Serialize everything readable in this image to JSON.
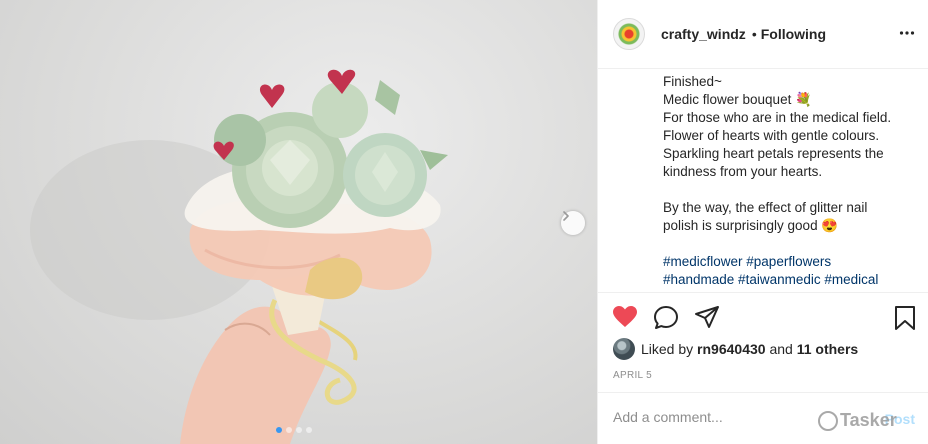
{
  "post": {
    "username": "crafty_windz",
    "separator": "•",
    "follow_status": "Following",
    "caption_lines": [
      "Finished~",
      "Medic flower bouquet 💐",
      "For those who are in the medical field.",
      "Flower of hearts with gentle colours.",
      "Sparkling heart petals represents the",
      "kindness from your hearts."
    ],
    "caption_lines_2": [
      "By the way, the effect of glitter nail",
      "polish is surprisingly good 😍"
    ],
    "hashtag_lines": [
      "#medicflower #paperflowers",
      "#handmade #taiwanmedic #medical"
    ],
    "likes": {
      "prefix": "Liked by",
      "user": "rn9640430",
      "conjunction": "and",
      "others": "11 others"
    },
    "date": "APRIL 5",
    "comment": {
      "placeholder": "Add a comment...",
      "post_label": "Post"
    }
  },
  "carousel": {
    "dot_count": 4,
    "active_index": 0
  },
  "icons": {
    "like": "heart-icon",
    "comment": "comment-icon",
    "share": "paper-plane-icon",
    "save": "bookmark-icon",
    "more": "more-options-icon",
    "next": "chevron-right-icon"
  },
  "colors": {
    "like_active": "#ed4956",
    "hashtag": "#003569",
    "post_disabled": "#b2dffc",
    "carousel_active": "#3897f0"
  },
  "watermark": {
    "text": "Tasker"
  }
}
